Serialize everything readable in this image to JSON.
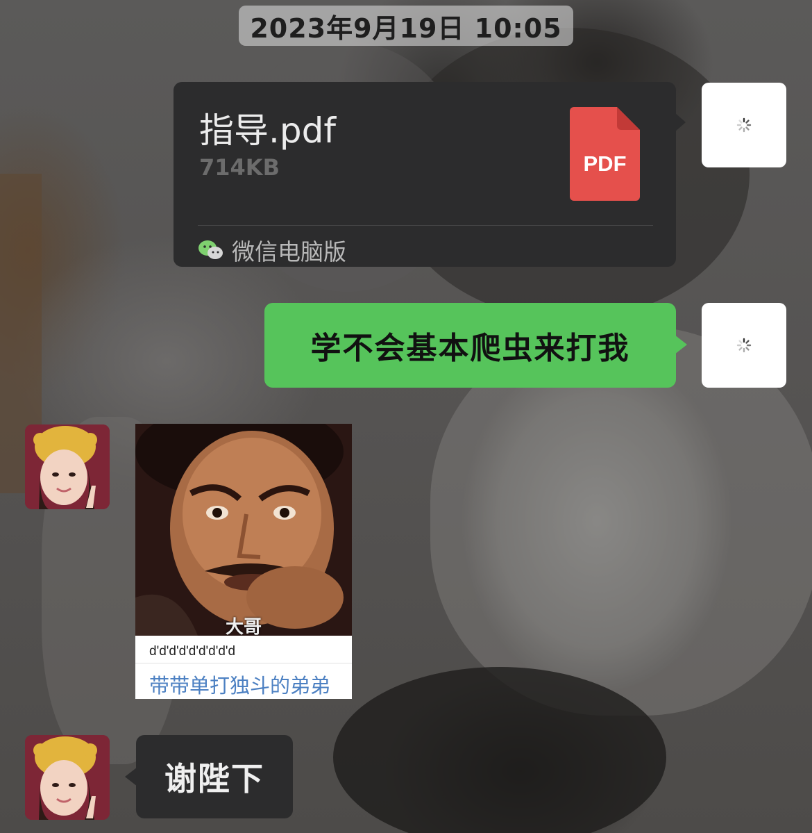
{
  "timestamp": "2023年9月19日 10:05",
  "messages": {
    "file": {
      "name": "指导.pdf",
      "size": "714KB",
      "type_label": "PDF",
      "source": "微信电脑版"
    },
    "text_sent": "学不会基本爬虫来打我",
    "sticker": {
      "caption": "大哥",
      "line1": "d'd'd'd'd'd'd'd'd",
      "line2": "带带单打独斗的弟弟"
    },
    "text_received": "谢陛下"
  },
  "colors": {
    "green_bubble": "#56c45b",
    "dark_bubble": "#2c2c2d",
    "pdf_red": "#e5504c",
    "link_blue": "#4c80c2"
  },
  "icons": {
    "loading": "loading-spinner-icon",
    "file": "pdf-file-icon",
    "source": "wechat-icon"
  }
}
